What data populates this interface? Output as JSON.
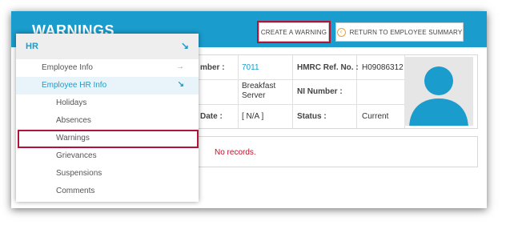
{
  "header": {
    "title": "WARNINGS",
    "create_label": "CREATE A WARNING",
    "return_label": "RETURN TO EMPLOYEE SUMMARY",
    "return_icon": "arrow-left-circle-icon"
  },
  "employee": {
    "number_label": "mber :",
    "number_value": "7011",
    "hmrc_label": "HMRC Ref. No. :",
    "hmrc_value": "H09086312",
    "job_value_line1": "Breakfast",
    "job_value_line2": "Server",
    "ni_label": "NI Number :",
    "ni_value": "",
    "date_label": "Date :",
    "date_value": "[ N/A ]",
    "status_label": "Status :",
    "status_value": "Current"
  },
  "records": {
    "message": "No records."
  },
  "menu": {
    "title": "HR",
    "items": [
      {
        "label": "Employee Info",
        "icon": "arrow-right-icon",
        "chev": "→"
      },
      {
        "label": "Employee HR Info",
        "icon": "arrow-down-right-icon",
        "chev": "↘"
      },
      {
        "label": "Holidays"
      },
      {
        "label": "Absences"
      },
      {
        "label": "Warnings"
      },
      {
        "label": "Grievances"
      },
      {
        "label": "Suspensions"
      },
      {
        "label": "Comments"
      }
    ]
  },
  "colors": {
    "accent": "#1a9ccc",
    "highlight": "#b0143a",
    "error": "#c0102a"
  }
}
